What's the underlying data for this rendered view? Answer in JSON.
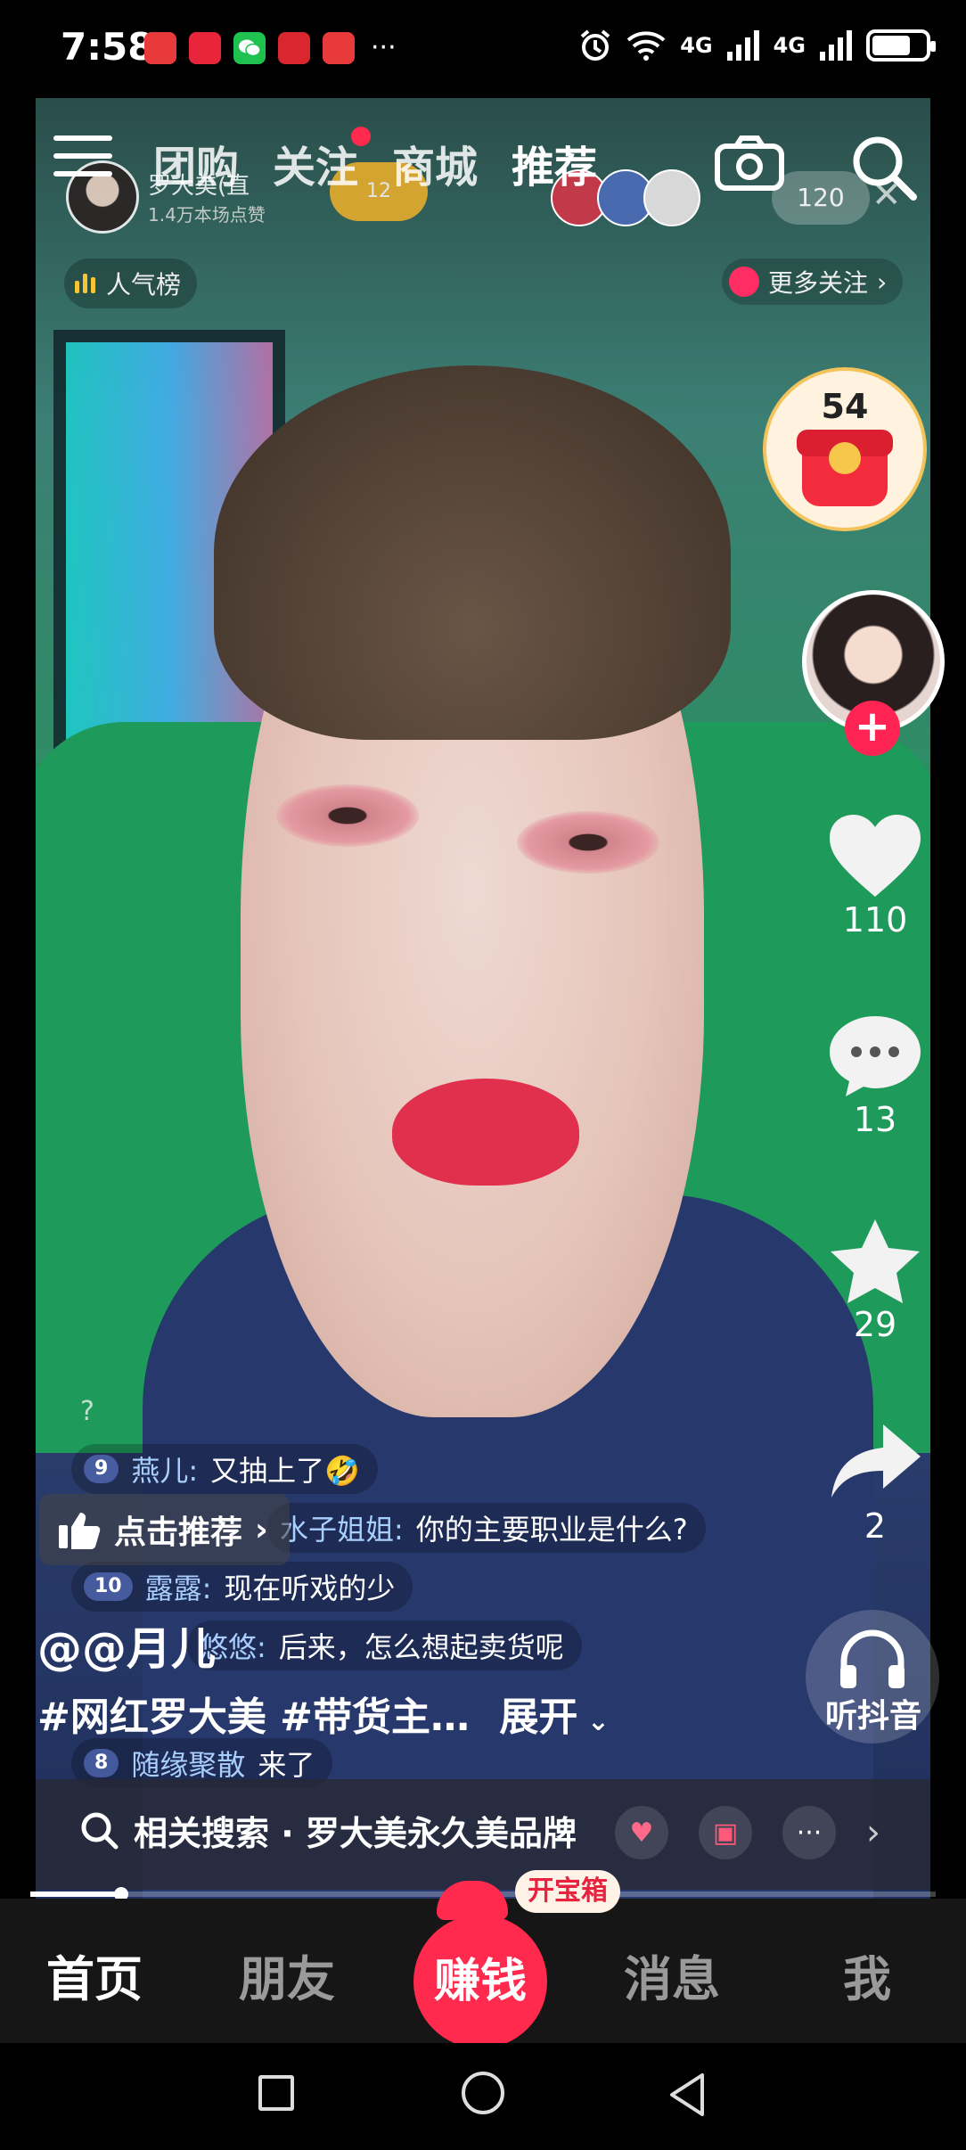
{
  "status_bar": {
    "time": "7:58",
    "apps": [
      {
        "name": "huawei-app-icon",
        "label": "HUAWEI",
        "color": "#e83a3a"
      },
      {
        "name": "shopping-app-icon",
        "label": "11.11",
        "color": "#e8253b"
      },
      {
        "name": "wechat-icon",
        "label": "",
        "color": "#1fc14f"
      },
      {
        "name": "festival-app-icon",
        "label": "11.11",
        "color": "#d9262f"
      },
      {
        "name": "store-app-icon",
        "label": "11.11",
        "color": "#e83a3a"
      }
    ],
    "more": "···",
    "network_1": "4G",
    "network_2": "4G"
  },
  "top_nav": {
    "tabs": [
      "团购",
      "关注",
      "商城",
      "推荐"
    ],
    "active_tab": "推荐"
  },
  "streamer": {
    "name": "罗大美(直",
    "subtitle": "1.4万本场点赞",
    "coin_count": "12",
    "viewer_count": "120",
    "rank_label": "人气榜",
    "more_follow": "更多关注"
  },
  "right_rail": {
    "redpacket_count": "54",
    "likes": "110",
    "comments": "13",
    "favorites": "29",
    "shares": "2",
    "listen_label": "听抖音"
  },
  "live_comments": {
    "question_mark": "?",
    "items": [
      {
        "level": "9",
        "user": "燕儿:",
        "text": "又抽上了🤣"
      },
      {
        "level": "",
        "user": "水子姐姐:",
        "text": "你的主要职业是什么?"
      },
      {
        "level": "10",
        "user": "露露:",
        "text": "现在听戏的少"
      },
      {
        "level": "",
        "user": "悠悠:",
        "text": "后来，怎么想起卖货呢"
      },
      {
        "level": "8",
        "user": "随缘聚散",
        "text": "来了"
      }
    ]
  },
  "recommend_label": "点击推荐",
  "video_info": {
    "author": "@@月儿",
    "tags": "#网红罗大美 #带货主…",
    "expand": "展开"
  },
  "related_search": {
    "text": "相关搜索 · 罗大美永久美品牌"
  },
  "progress": {
    "fraction": 0.1
  },
  "tab_bar": {
    "home": "首页",
    "friends": "朋友",
    "earn": "赚钱",
    "treasure": "开宝箱",
    "messages": "消息",
    "me": "我"
  },
  "colors": {
    "accent": "#ff2a4d",
    "redpacket_border": "#f3c45b"
  }
}
